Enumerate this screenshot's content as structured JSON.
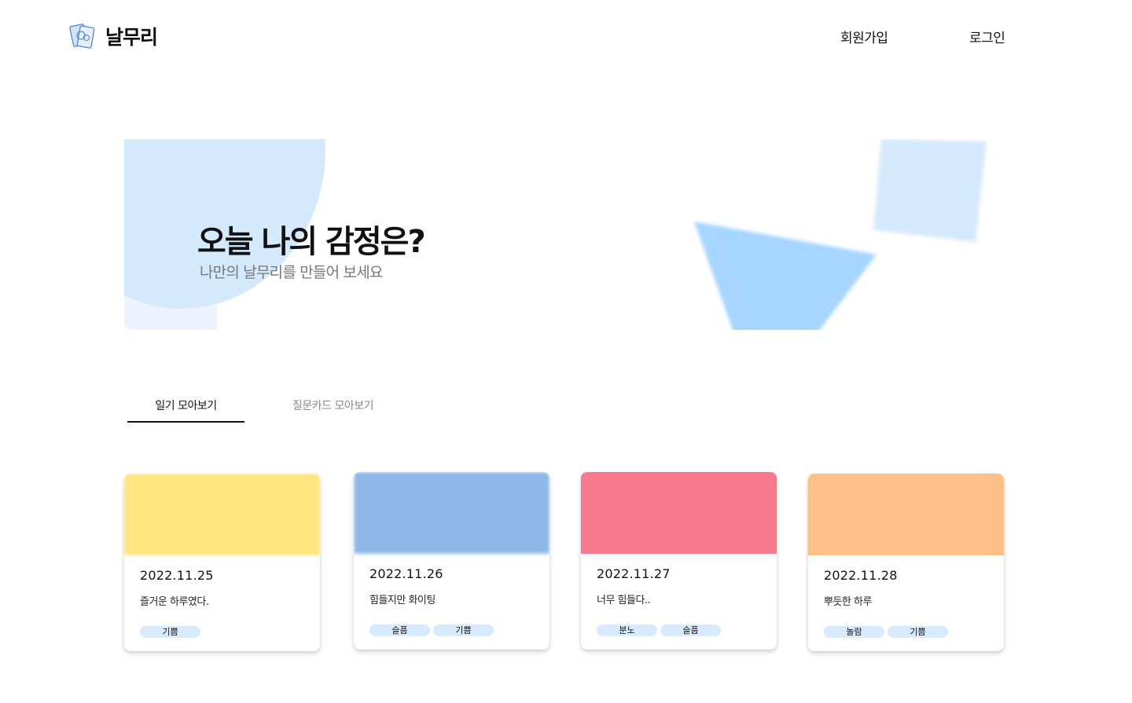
{
  "header": {
    "brand": "날무리",
    "logo_icon": "card-deck-icon",
    "signup": "회원가입",
    "login": "로그인"
  },
  "hero": {
    "title": "오늘 나의 감정은?",
    "subtitle": "나만의 날무리를 만들어 보세요"
  },
  "tabs": [
    {
      "label": "일기 모아보기",
      "active": true
    },
    {
      "label": "질문카드 모아보기",
      "active": false
    }
  ],
  "cards": [
    {
      "date": "2022.11.25",
      "text": "즐거운 하루였다.",
      "color": "#ffe680",
      "tags": [
        "기쁨"
      ]
    },
    {
      "date": "2022.11.26",
      "text": "힘들지만 화이팅",
      "color": "#8fb8e8",
      "tags": [
        "슬픔",
        "기쁨"
      ]
    },
    {
      "date": "2022.11.27",
      "text": "너무 힘들다..",
      "color": "#f7798b",
      "tags": [
        "분노",
        "슬픔"
      ]
    },
    {
      "date": "2022.11.28",
      "text": "뿌듯한 하루",
      "color": "#fcc088",
      "tags": [
        "놀람",
        "기쁨"
      ]
    }
  ],
  "colors": {
    "accent_light": "#d5e9fd",
    "shape_blue": "#a6d6ff",
    "tag_bg": "#d8eafd"
  }
}
